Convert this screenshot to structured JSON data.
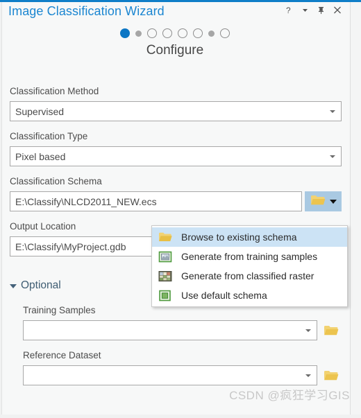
{
  "window": {
    "title": "Image Classification Wizard",
    "buttons": [
      {
        "name": "help-button",
        "glyph": "?"
      },
      {
        "name": "menu-caret-button",
        "glyph": "▾"
      },
      {
        "name": "pin-button",
        "glyph": "⚐"
      },
      {
        "name": "close-button",
        "glyph": "✕"
      }
    ],
    "accent_color": "#0f7ec8",
    "title_color": "#1b86d1"
  },
  "wizard": {
    "step_title": "Configure",
    "steps": [
      {
        "state": "current"
      },
      {
        "state": "small"
      },
      {
        "state": "pending"
      },
      {
        "state": "pending"
      },
      {
        "state": "pending"
      },
      {
        "state": "pending"
      },
      {
        "state": "small"
      },
      {
        "state": "pending"
      }
    ],
    "active_color": "#0c76c4",
    "small_color": "#a6a6a6",
    "pending_color": "#8d8d8d"
  },
  "form": {
    "classification_method": {
      "label": "Classification Method",
      "value": "Supervised"
    },
    "classification_type": {
      "label": "Classification Type",
      "value": "Pixel based"
    },
    "classification_schema": {
      "label": "Classification Schema",
      "value": "E:\\Classify\\NLCD2011_NEW.ecs",
      "button_name": "schema-browse-split-button"
    },
    "output_location": {
      "label": "Output Location",
      "value": "E:\\Classify\\MyProject.gdb"
    }
  },
  "optional": {
    "header": "Optional",
    "training_samples": {
      "label": "Training Samples",
      "value": "",
      "placeholder": ""
    },
    "reference_dataset": {
      "label": "Reference Dataset",
      "value": "",
      "placeholder": ""
    }
  },
  "schema_menu": {
    "items": [
      {
        "label": "Browse to existing schema",
        "icon": "folder-icon",
        "highlighted": true
      },
      {
        "label": "Generate from training samples",
        "icon": "training-samples-icon",
        "highlighted": false
      },
      {
        "label": "Generate from classified raster",
        "icon": "classified-raster-icon",
        "highlighted": false
      },
      {
        "label": "Use default schema",
        "icon": "default-schema-icon",
        "highlighted": false
      }
    ],
    "highlight_color": "#cce3f5"
  },
  "watermark": {
    "text": "CSDN @疯狂学习GIS"
  }
}
